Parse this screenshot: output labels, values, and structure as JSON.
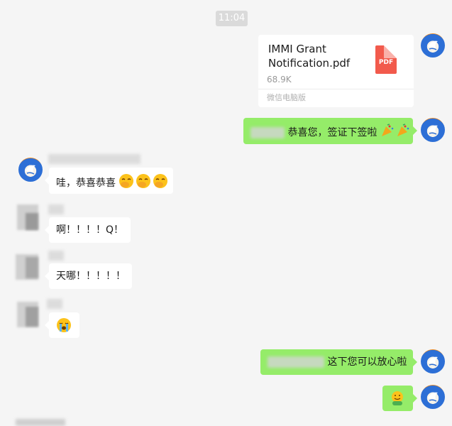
{
  "timestamp": "11:04",
  "file_message": {
    "file_name": "IMMI Grant Notification.pdf",
    "file_size": "68.9K",
    "source": "微信电脑版",
    "file_type": "PDF"
  },
  "messages": [
    {
      "side": "out",
      "text": "恭喜您，签证下签啦",
      "emoji": "party-popper-icon"
    },
    {
      "side": "in",
      "text": "哇，恭喜恭喜",
      "emoji": "laughing-hand-over-mouth-icon"
    },
    {
      "side": "in",
      "text": "啊！！！！Q！"
    },
    {
      "side": "in",
      "text": "天哪！！！！！"
    },
    {
      "side": "in",
      "emoji": "crying-face-icon"
    },
    {
      "side": "out",
      "text": "这下您可以放心啦"
    },
    {
      "side": "out",
      "emoji": "hugging-face-icon"
    }
  ],
  "colors": {
    "background": "#f5f5f5",
    "outgoing_bubble": "#95ec69",
    "incoming_bubble": "#ffffff",
    "pdf_icon": "#f25a4c"
  }
}
